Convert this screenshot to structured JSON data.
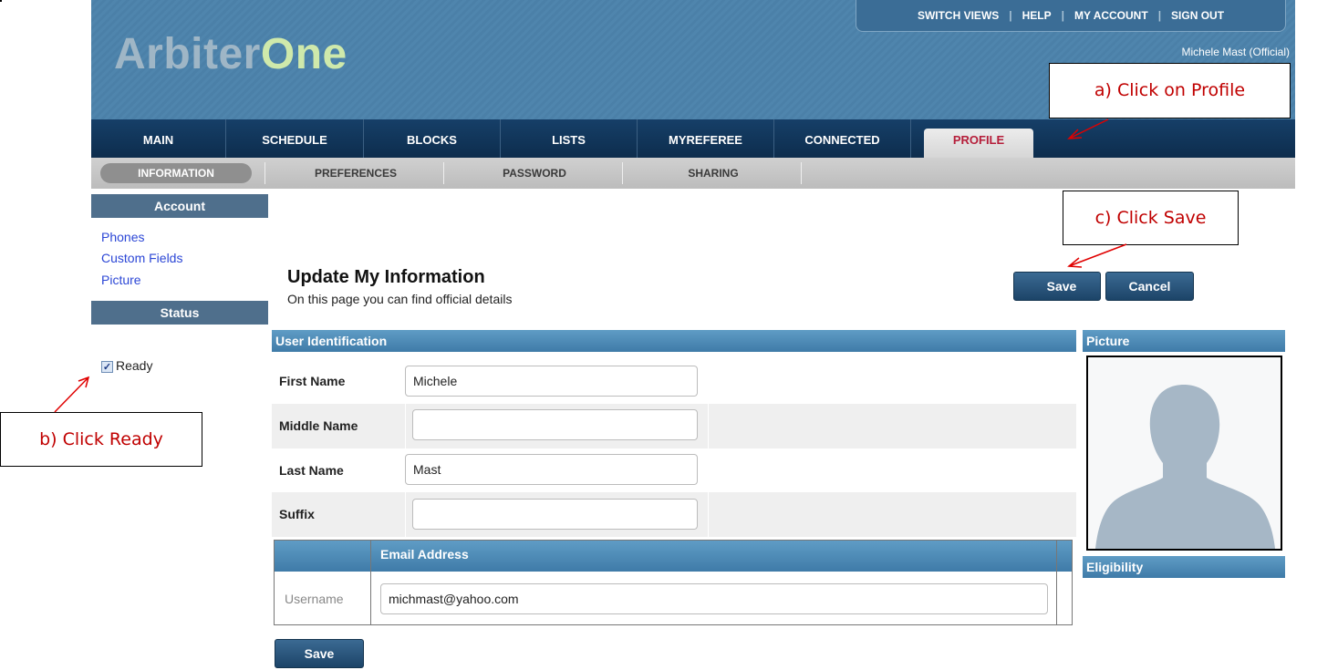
{
  "app": {
    "logo_part1": "Arbiter",
    "logo_part2": "One",
    "top_links": [
      "SWITCH VIEWS",
      "HELP",
      "MY ACCOUNT",
      "SIGN OUT"
    ],
    "user_label": "Michele Mast (Official)"
  },
  "main_nav": [
    "MAIN",
    "SCHEDULE",
    "BLOCKS",
    "LISTS",
    "MYREFEREE",
    "CONNECTED",
    "PROFILE"
  ],
  "main_nav_active": "PROFILE",
  "sub_nav": [
    "INFORMATION",
    "PREFERENCES",
    "PASSWORD",
    "SHARING"
  ],
  "sub_nav_active": "INFORMATION",
  "sidebar": {
    "account_header": "Account",
    "links": [
      "Phones",
      "Custom Fields",
      "Picture"
    ],
    "status_header": "Status",
    "ready_label": "Ready",
    "ready_checked": true
  },
  "page": {
    "title": "Update My Information",
    "subtitle": "On this page you can find official details",
    "save_label": "Save",
    "cancel_label": "Cancel",
    "bottom_save_label": "Save"
  },
  "user_identification": {
    "header": "User Identification",
    "fields": [
      {
        "label": "First Name",
        "value": "Michele"
      },
      {
        "label": "Middle Name",
        "value": ""
      },
      {
        "label": "Last Name",
        "value": "Mast"
      },
      {
        "label": "Suffix",
        "value": ""
      }
    ]
  },
  "email": {
    "header": "Email Address",
    "row_label": "Username",
    "value": "michmast@yahoo.com"
  },
  "picture": {
    "header": "Picture",
    "eligibility_header": "Eligibility"
  },
  "annotations": {
    "a": "a) Click on Profile",
    "b": "b) Click Ready",
    "c": "c) Click Save"
  },
  "colors": {
    "header_blue": "#4f85ad",
    "nav_dark": "#163f68",
    "profile_red": "#b51e3a",
    "annotation_red": "#c00000",
    "link_blue": "#2c47d6"
  }
}
